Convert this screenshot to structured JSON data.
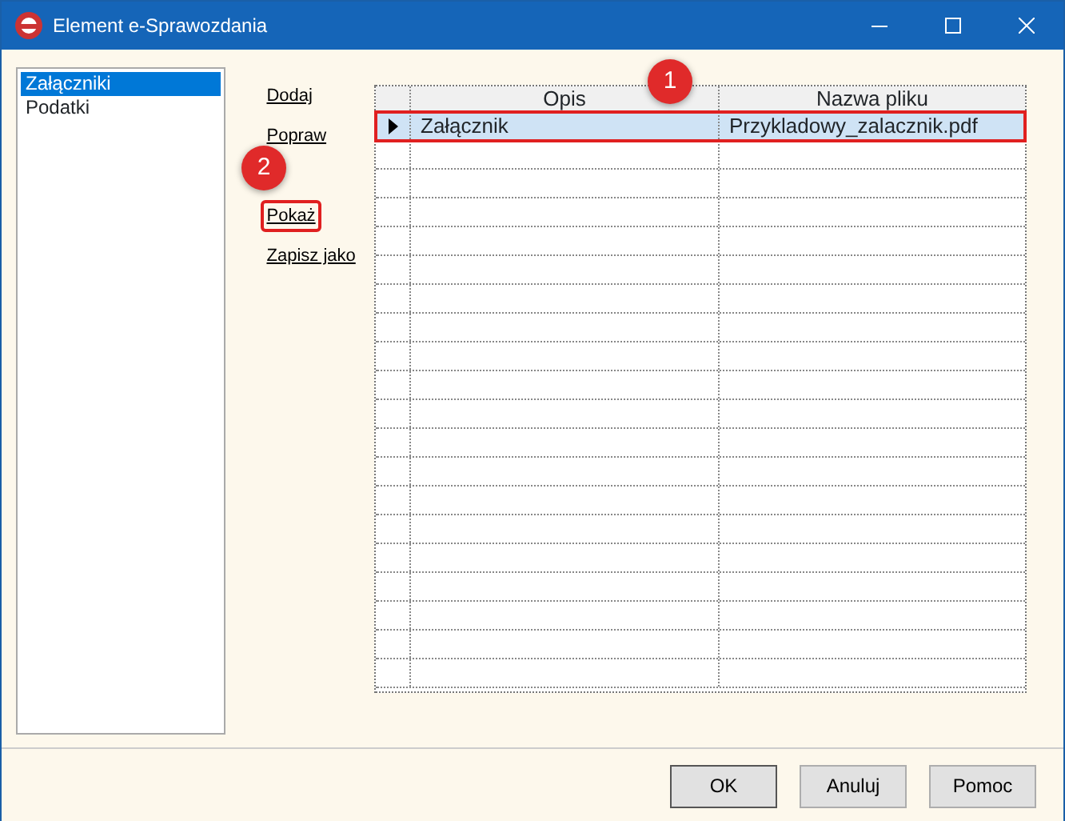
{
  "window": {
    "title": "Element e-Sprawozdania"
  },
  "sidebar": {
    "items": [
      {
        "label": "Załączniki",
        "selected": true
      },
      {
        "label": "Podatki",
        "selected": false
      }
    ]
  },
  "actions": [
    {
      "label": "Dodaj",
      "highlighted": false
    },
    {
      "label": "Popraw",
      "highlighted": false
    },
    {
      "label": "Pokaż",
      "highlighted": true
    },
    {
      "label": "Zapisz jako",
      "highlighted": false
    }
  ],
  "table": {
    "columns": [
      "Opis",
      "Nazwa pliku"
    ],
    "rows": [
      {
        "cells": [
          "Załącznik",
          "Przykladowy_zalacznik.pdf"
        ],
        "selected": true,
        "highlighted": true
      }
    ]
  },
  "annotations": [
    {
      "text": "1"
    },
    {
      "text": "2"
    }
  ],
  "buttons": [
    "OK",
    "Anuluj",
    "Pomoc"
  ]
}
